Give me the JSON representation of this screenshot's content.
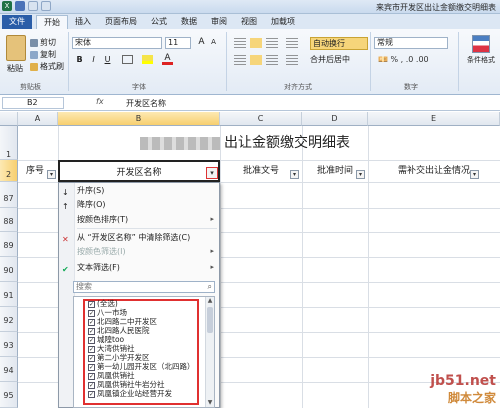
{
  "window": {
    "title": "来宾市开发区出让金额缴交明细表"
  },
  "ribbon": {
    "tabs": [
      "文件",
      "开始",
      "插入",
      "页面布局",
      "公式",
      "数据",
      "审阅",
      "视图",
      "加载项"
    ],
    "clipboard": {
      "paste": "粘贴",
      "cut": "剪切",
      "copy": "复制",
      "format_painter": "格式刷",
      "label": "剪贴板"
    },
    "font": {
      "name": "宋体",
      "size": "11",
      "label": "字体",
      "bold": "B",
      "italic": "I",
      "underline": "U",
      "grow": "A",
      "shrink": "A"
    },
    "alignment": {
      "wrap_text": "自动换行",
      "merge_center": "合并后居中",
      "label": "对齐方式"
    },
    "number": {
      "format": "常规",
      "label": "数字"
    },
    "styles": {
      "conditional": "条件格式"
    }
  },
  "formula_bar": {
    "name_box": "B2",
    "fx": "fx",
    "content": "开发区名称"
  },
  "grid": {
    "columns": [
      "A",
      "B",
      "C",
      "D",
      "E"
    ],
    "rows": [
      "1",
      "2",
      "87",
      "88",
      "89",
      "90",
      "91",
      "92",
      "93",
      "94",
      "95"
    ],
    "sheet_title": "出让金额缴交明细表",
    "headers": {
      "seq": "序号",
      "zone": "开发区名称",
      "doc_no": "批准文号",
      "time": "批准时间",
      "extra": "需补交出让金情况"
    }
  },
  "filter_menu": {
    "sort_asc": "升序(S)",
    "sort_desc": "降序(O)",
    "sort_by_color": "按颜色排序(T)",
    "clear_filter": "从 “开发区名称” 中清除筛选(C)",
    "filter_by_color": "按颜色筛选(I)",
    "text_filter": "文本筛选(F)",
    "search_placeholder": "搜索",
    "items": [
      "(全选)",
      "八一市场",
      "北四路二中开发区",
      "北四路人民医院",
      "城隍too",
      "大湾供销社",
      "第二小学开发区",
      "第一幼儿园开发区（北四路）",
      "凤凰供销社",
      "凤凰供销社牛岩分社",
      "凤凰镇企业站经营开发"
    ]
  },
  "watermark": {
    "line1": "jb51.net",
    "line2": "脚本之家"
  }
}
